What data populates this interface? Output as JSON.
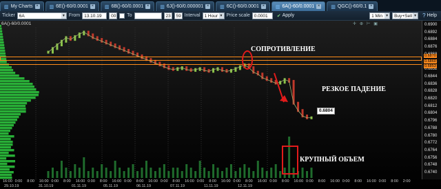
{
  "tabs": [
    {
      "label": "My Charts",
      "active": false,
      "icon": "chart-icon"
    },
    {
      "label": "6E()-60/0.0001",
      "active": false,
      "icon": "chart-icon"
    },
    {
      "label": "6B()-60/0.0001",
      "active": false,
      "icon": "chart-icon"
    },
    {
      "label": "6J()-60/0.000001",
      "active": false,
      "icon": "chart-icon"
    },
    {
      "label": "6C()-60/0.0001",
      "active": false,
      "icon": "chart-icon"
    },
    {
      "label": "6A()-60/0.0001",
      "active": true,
      "icon": "chart-icon"
    },
    {
      "label": "QGC()-60/0.1",
      "active": false,
      "icon": "chart-icon"
    }
  ],
  "toolbar": {
    "ticker_label": "Ticker",
    "ticker_value": "6A",
    "from_label": "From",
    "from_date": "13.10.19",
    "from_hour": "00",
    "to_label": "To",
    "to_hour": "23",
    "to_minute": "59",
    "interval_label": "Interval",
    "interval_value": "1 Hour",
    "price_scale_label": "Price scale",
    "price_scale_value": "0.0001",
    "apply_label": "Apply",
    "timeframe_value": "1 Min",
    "side_value": "Buy+Sell",
    "help_label": "Help"
  },
  "chart": {
    "series_label": "6A()-60/0.0001",
    "price_ticks": [
      "0.6900",
      "0.6892",
      "0.6884",
      "0.6876",
      "0.6868",
      "0.6860",
      "0.6852",
      "0.6844",
      "0.6836",
      "0.6828",
      "0.6820",
      "0.6812",
      "0.6804",
      "0.6796",
      "0.6788",
      "0.6780",
      "0.6772",
      "0.6764",
      "0.6756",
      "0.6748",
      "0.6740"
    ],
    "price_badges": [
      "0.6870",
      "0.6860",
      "0.6853"
    ],
    "last_price_tag": "0.6804",
    "annotations": {
      "resistance": "СОПРОТИВЛЕНИЕ",
      "sharp_drop": "РЕЗКОЕ ПАДЕНИЕ",
      "big_volume": "КРУПНЫЙ ОБЪЕМ"
    },
    "time_labels": [
      "16:00",
      "0:00",
      "8:00",
      "16:00",
      "0:00",
      "8:00",
      "16:00",
      "0:00",
      "8:00",
      "16:00",
      "0:00",
      "8:00",
      "16:00",
      "0:00",
      "8:00",
      "16:00",
      "0:00",
      "8:00",
      "16:00",
      "0:00",
      "8:00",
      "16:00",
      "0:00",
      "8:00",
      "16:00",
      "0:00",
      "8:00",
      "16:00",
      "0:00",
      "8:00",
      "16:00",
      "0:00",
      "8:00",
      "2:00"
    ],
    "date_labels": [
      "29.10.19",
      "31.10.19",
      "01.11.19",
      "05.11.19",
      "06.11.19",
      "07.11.19",
      "11.11.19",
      "12.11.19"
    ],
    "colors": {
      "level": "#ff8c1a",
      "marker": "#e21b1b",
      "profile": "#2ecc40",
      "candle_up": "#8bc34a",
      "candle_down": "#c0392b",
      "volume": "#1f6b2c"
    }
  },
  "chart_data": {
    "type": "line",
    "x": [
      0,
      1,
      2,
      3,
      4,
      5,
      6,
      7,
      8,
      9,
      10,
      11,
      12,
      13,
      14,
      15,
      16,
      17,
      18,
      19,
      20,
      21,
      22,
      23,
      24,
      25,
      26,
      27,
      28,
      29,
      30,
      31,
      32,
      33,
      34,
      35,
      36,
      37,
      38,
      39,
      40,
      41,
      42,
      43,
      44,
      45,
      46,
      47,
      48,
      49,
      50,
      51,
      52,
      53,
      54,
      55,
      56,
      57,
      58,
      59
    ],
    "y": [
      0.6876,
      0.688,
      0.6884,
      0.6888,
      0.6892,
      0.689,
      0.6893,
      0.6896,
      0.6898,
      0.6895,
      0.6892,
      0.689,
      0.6888,
      0.6886,
      0.6884,
      0.6882,
      0.688,
      0.6878,
      0.6876,
      0.6874,
      0.6872,
      0.687,
      0.6868,
      0.6866,
      0.6864,
      0.6862,
      0.686,
      0.6858,
      0.6857,
      0.6858,
      0.6859,
      0.6857,
      0.6856,
      0.6857,
      0.6858,
      0.6856,
      0.6855,
      0.6857,
      0.6858,
      0.6856,
      0.6855,
      0.6856,
      0.6858,
      0.686,
      0.6862,
      0.6859,
      0.6854,
      0.6852,
      0.6848,
      0.6846,
      0.6844,
      0.6842,
      0.6843,
      0.6846,
      0.6844,
      0.682,
      0.6812,
      0.6806,
      0.6804,
      0.6804
    ],
    "ylim": [
      0.6738,
      0.6906
    ],
    "levels": [
      0.687,
      0.686,
      0.6853
    ],
    "volume": [
      2,
      3,
      2,
      5,
      3,
      2,
      4,
      3,
      6,
      2,
      3,
      2,
      4,
      3,
      2,
      5,
      3,
      2,
      3,
      4,
      2,
      3,
      5,
      3,
      2,
      3,
      4,
      2,
      3,
      3,
      2,
      4,
      3,
      2,
      5,
      3,
      2,
      4,
      3,
      2,
      3,
      4,
      2,
      3,
      4,
      3,
      2,
      5,
      3,
      2,
      3,
      4,
      2,
      3,
      12,
      3,
      2,
      3,
      2,
      3
    ]
  }
}
